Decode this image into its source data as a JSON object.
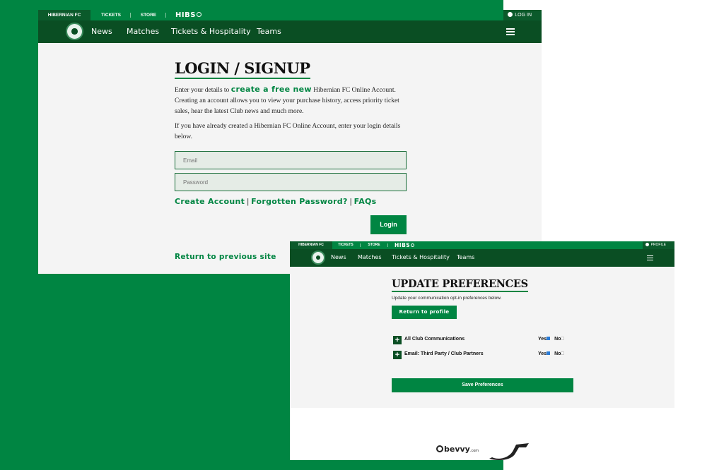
{
  "window1": {
    "topbar": {
      "items": [
        "HIBERNIAN FC",
        "TICKETS",
        "STORE"
      ],
      "hibs_logo": "HIBS",
      "login": "LOG IN"
    },
    "nav": {
      "items": [
        "News",
        "Matches",
        "Tickets & Hospitality",
        "Teams"
      ]
    },
    "heading": "LOGIN / SIGNUP",
    "intro_before": "Enter your details to ",
    "intro_link": "create a free new",
    "intro_after": " Hibernian FC Online Account. Creating an account allows you to view your purchase history, access priority ticket sales, hear the latest Club news and much more.",
    "existing_text": "If you have already created a Hibernian FC Online Account, enter your login details below.",
    "email_placeholder": "Email",
    "password_placeholder": "Password",
    "links": {
      "create_account": "Create Account",
      "forgotten_password": "Forgotten Password?",
      "faqs": "FAQs",
      "separator": "|"
    },
    "login_button": "Login",
    "return_link": "Return to previous site"
  },
  "window2": {
    "topbar": {
      "items": [
        "HIBERNIAN FC",
        "TICKETS",
        "STORE"
      ],
      "hibs_logo": "HIBS",
      "profile": "PROFILE"
    },
    "nav": {
      "items": [
        "News",
        "Matches",
        "Tickets & Hospitality",
        "Teams"
      ]
    },
    "heading": "UPDATE PREFERENCES",
    "description": "Update your communication opt-in preferences below.",
    "return_button": "Return to profile",
    "preferences": [
      {
        "label": "All Club Communications",
        "yes": "Yes",
        "no": "No"
      },
      {
        "label": "Email: Third Party / Club Partners",
        "yes": "Yes",
        "no": "No"
      }
    ],
    "save_button": "Save Preferences",
    "sponsors": {
      "bevvy": "bevvy",
      "bevvy_suffix": ".com"
    }
  },
  "colors": {
    "brand_green": "#008542",
    "dark_green": "#0a4e23",
    "page_bg": "#f4f4f4"
  }
}
